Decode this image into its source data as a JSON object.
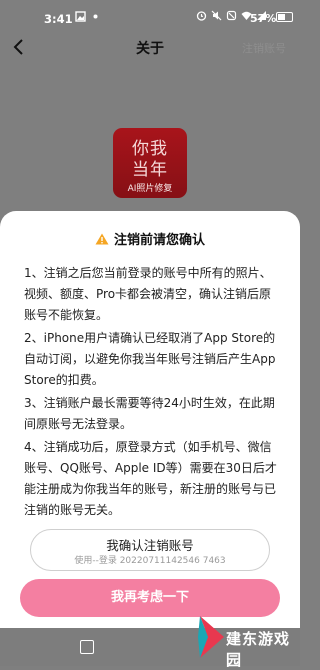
{
  "status_bar": {
    "time": "3:41",
    "battery": "57%"
  },
  "header": {
    "title": "关于",
    "right_action": "注销账号"
  },
  "app_logo": {
    "line1": "你我",
    "line2": "当年",
    "tagline": "AI照片修复"
  },
  "dialog": {
    "title": "注销前请您确认",
    "paragraphs": [
      "1、注销之后您当前登录的账号中所有的照片、视频、额度、Pro卡都会被清空，确认注销后原账号不能恢复。",
      "2、iPhone用户请确认已经取消了App Store的自动订阅，以避免你我当年账号注销后产生App Store的扣费。",
      "3、注销账户最长需要等待24小时生效，在此期间原账号无法登录。",
      "4、注销成功后，原登录方式（如手机号、微信账号、QQ账号、Apple ID等）需要在30日后才能注册成为你我当年的账号，新注册的账号与已注销的账号无关。"
    ],
    "confirm_button": "我确认注销账号",
    "confirm_sub": "使用--登录 20220711142546 7463",
    "cancel_button": "我再考虑一下"
  },
  "watermark": {
    "text": "建东游戏园"
  },
  "colors": {
    "accent_pink": "#f47fa1",
    "logo_red": "#a8141b",
    "overlay": "#7f7f7f"
  }
}
